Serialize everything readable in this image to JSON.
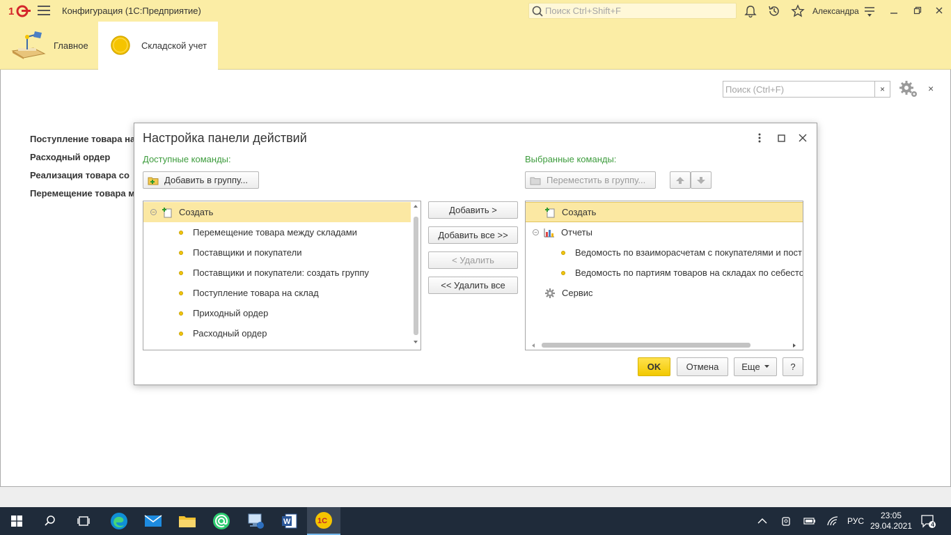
{
  "titlebar": {
    "app_title": "Конфигурация  (1С:Предприятие)",
    "search_placeholder": "Поиск Ctrl+Shift+F",
    "user": "Александра"
  },
  "sections": [
    {
      "label": "Главное"
    },
    {
      "label": "Складской учет"
    }
  ],
  "page": {
    "search_placeholder": "Поиск (Ctrl+F)",
    "clear_label": "×",
    "close_label": "×",
    "links": [
      "Поступление товара на",
      "Расходный ордер",
      "Реализация товара со",
      "Перемещение товара м"
    ]
  },
  "dialog": {
    "title": "Настройка панели действий",
    "available_caption": "Доступные команды:",
    "selected_caption": "Выбранные команды:",
    "add_to_group": "Добавить в группу...",
    "move_to_group": "Переместить в группу...",
    "btn_add": "Добавить >",
    "btn_add_all": "Добавить все >>",
    "btn_remove": "< Удалить",
    "btn_remove_all": "<< Удалить все",
    "btn_ok": "OK",
    "btn_cancel": "Отмена",
    "btn_more": "Еще",
    "btn_help": "?",
    "available": {
      "group": "Создать",
      "items": [
        "Перемещение товара между складами",
        "Поставщики и покупатели",
        "Поставщики и покупатели: создать группу",
        "Поступление товара на склад",
        "Приходный ордер",
        "Расходный ордер"
      ]
    },
    "selected": {
      "create": "Создать",
      "reports": "Отчеты",
      "report_items": [
        "Ведомость по взаиморасчетам с покупателями и пост",
        "Ведомость по партиям товаров на складах по себесто"
      ],
      "service": "Сервис"
    }
  },
  "taskbar": {
    "lang": "РУС",
    "time": "23:05",
    "date": "29.04.2021",
    "notifications": "4"
  },
  "colors": {
    "accent_yellow": "#fbeda5",
    "selection": "#fbe8a3",
    "caption_green": "#3d9c3d",
    "ok_button": "#f2c900",
    "taskbar": "#1f2b3a"
  }
}
